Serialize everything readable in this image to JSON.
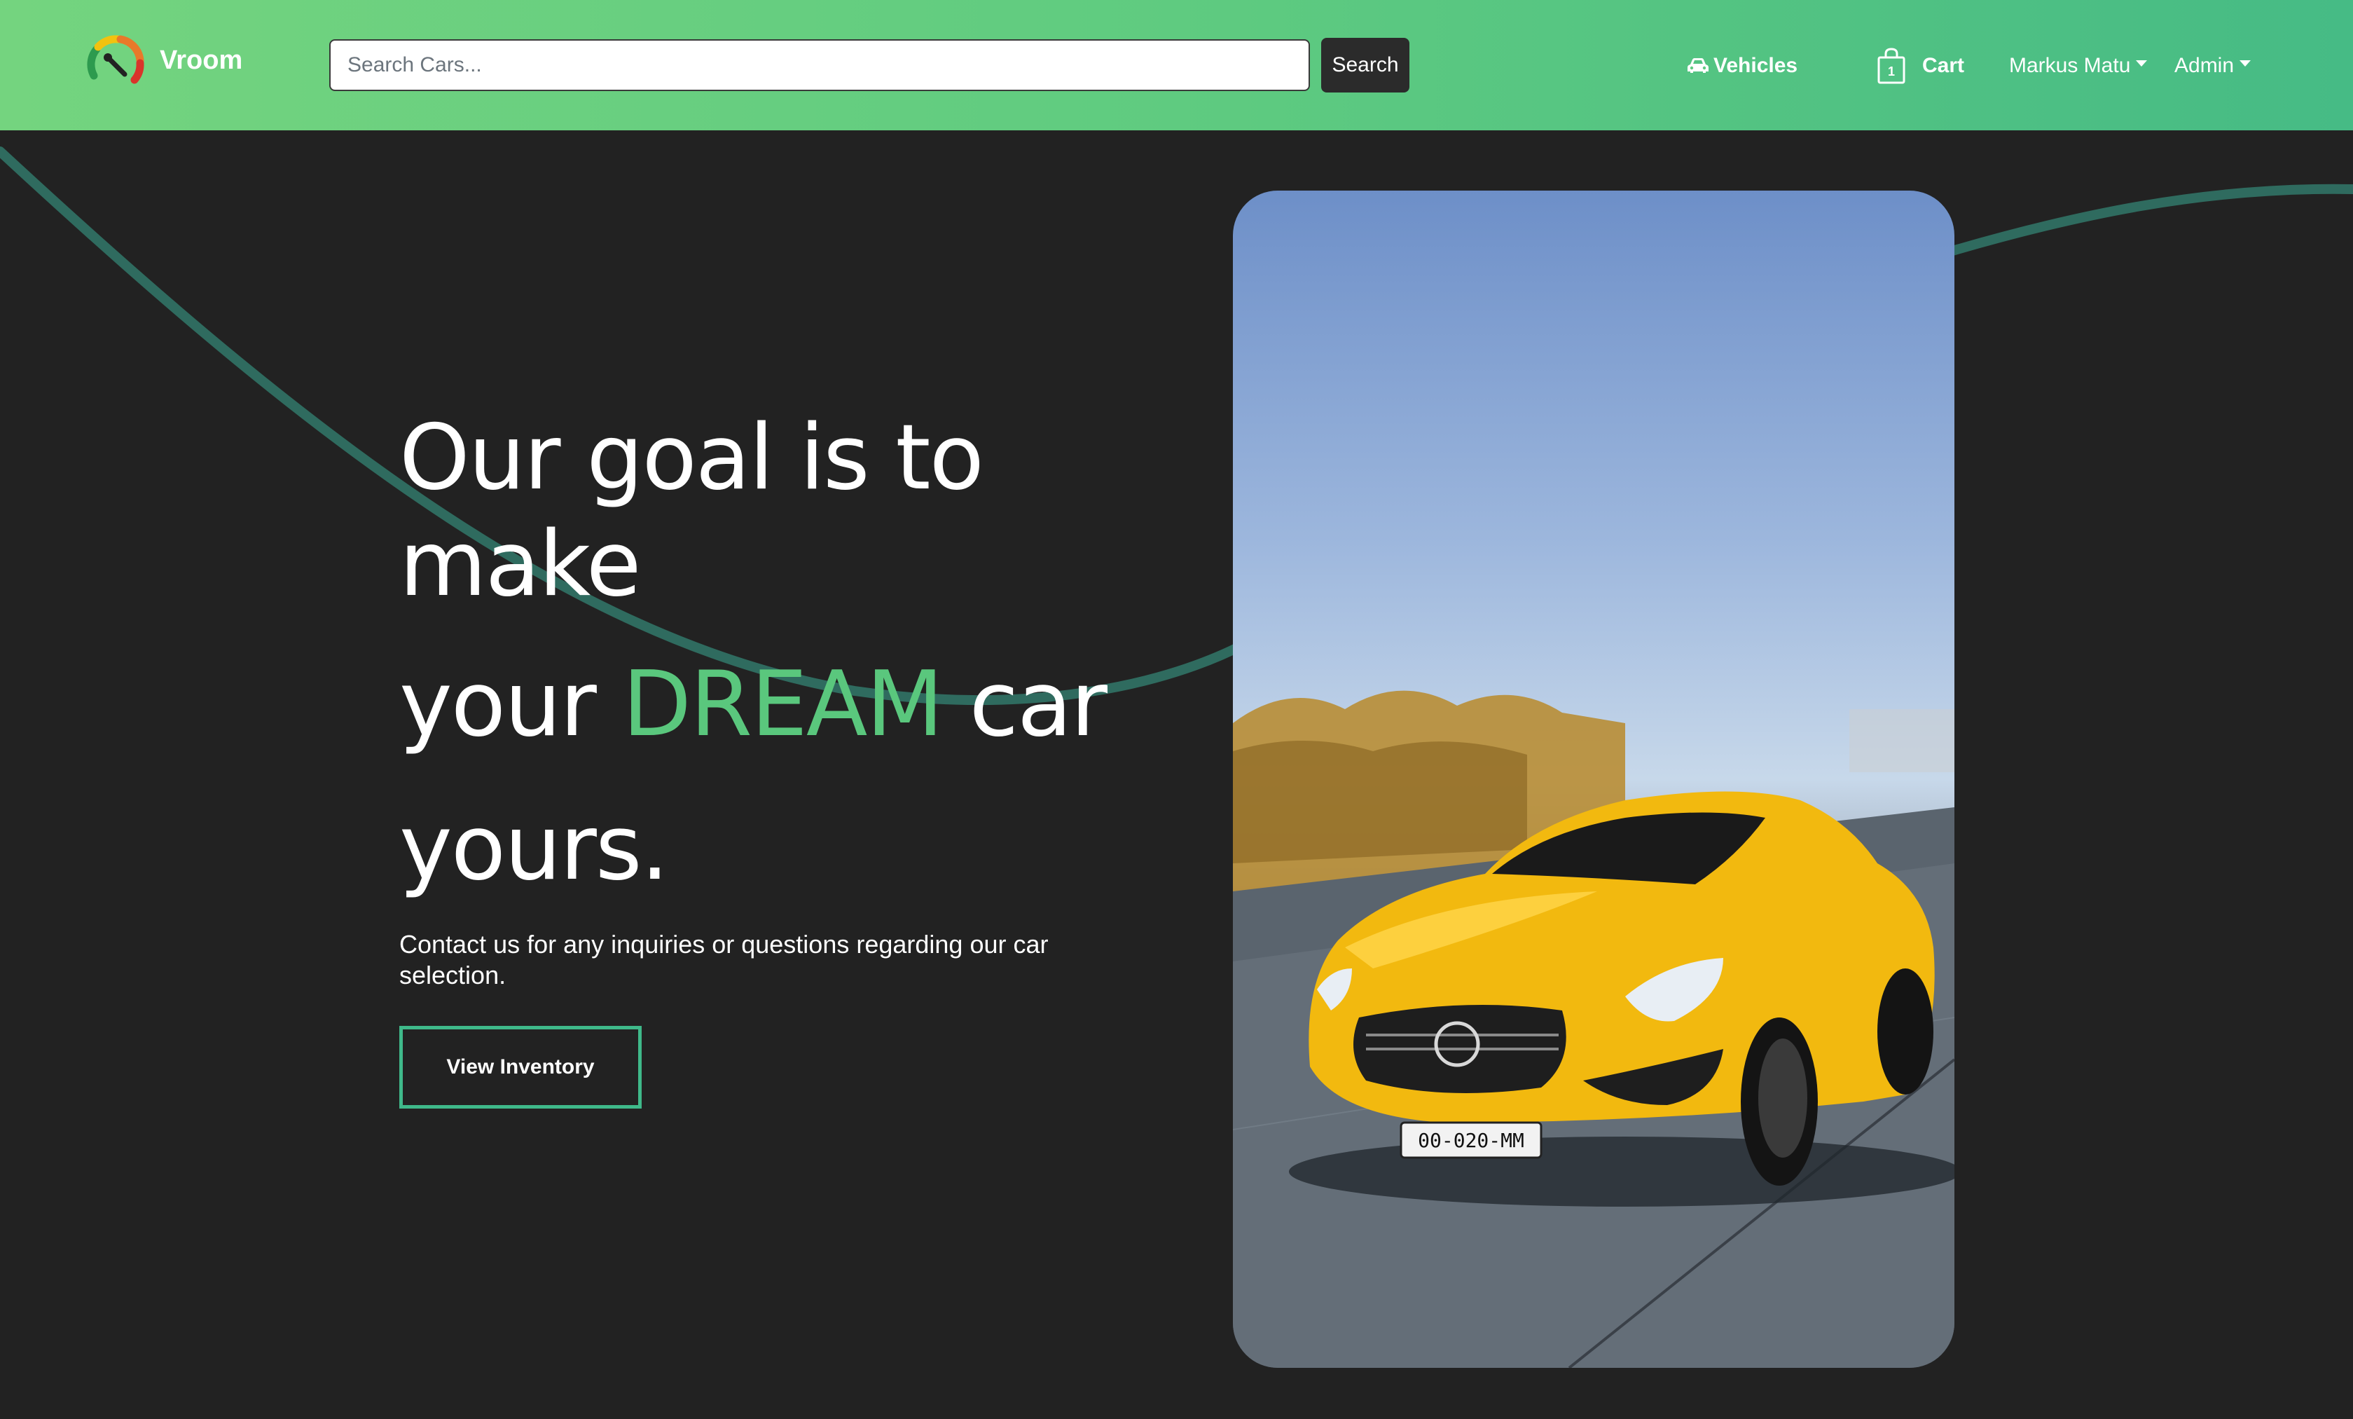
{
  "header": {
    "brand": "Vroom",
    "search_placeholder": "Search Cars...",
    "search_button": "Search",
    "nav": {
      "vehicles": "Vehicles",
      "cart": "Cart",
      "cart_count": "1",
      "user": "Markus Matu",
      "admin": "Admin"
    }
  },
  "hero": {
    "title_line1": "Our goal is to",
    "title_line2": "make",
    "title_line3_pre": "your ",
    "title_line3_accent": "DREAM",
    "title_line3_post": " car",
    "title_line4": "yours.",
    "subtitle": "Contact us for any inquiries or questions regarding our car selection.",
    "cta": "View Inventory",
    "plate": "00-020-MM"
  },
  "colors": {
    "navbar_gradient": [
      "#74d47f",
      "#46bb85"
    ],
    "background": "#222222",
    "accent": "#5ac77d",
    "cta_border": "#3fb98a",
    "wave": "#2f6b5f",
    "car": "#f2b90f"
  },
  "icons": {
    "brand": "speedometer-logo-icon",
    "vehicles": "car-icon",
    "cart": "shopping-bag-icon"
  }
}
